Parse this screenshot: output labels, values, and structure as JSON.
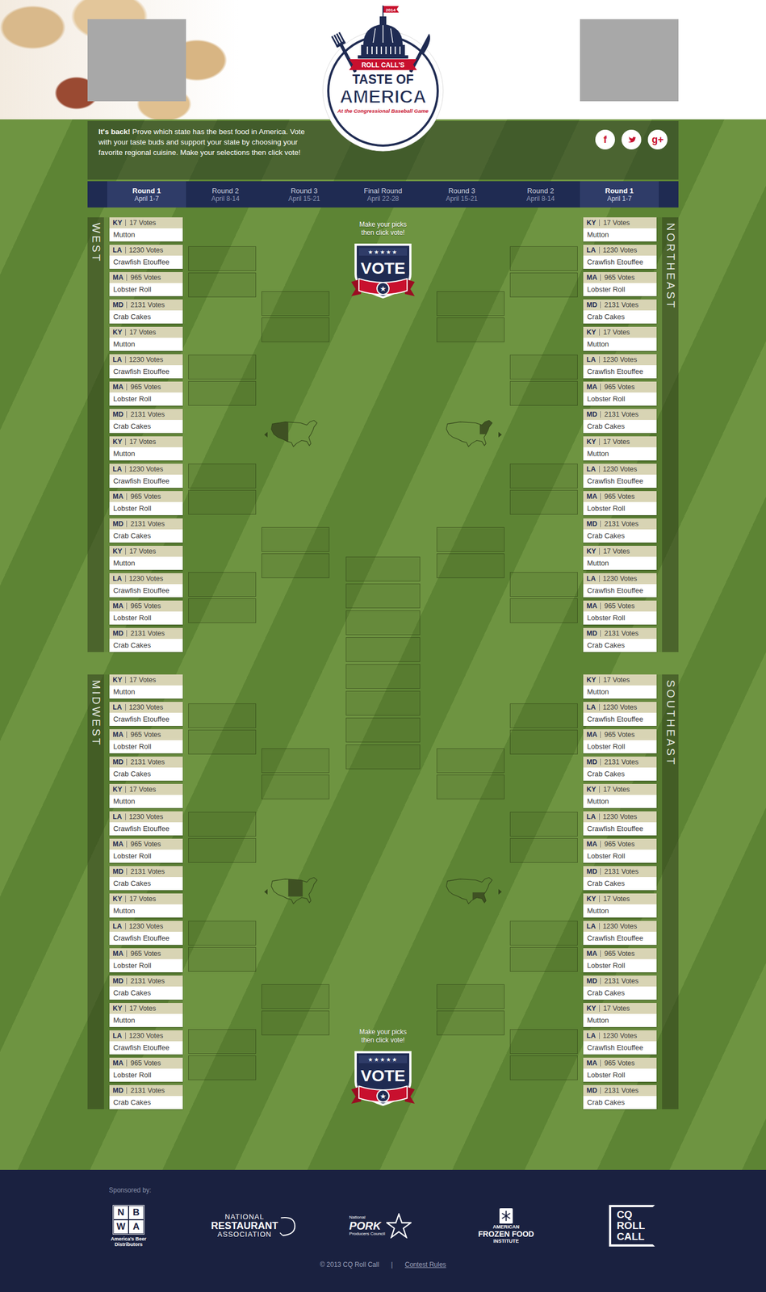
{
  "header": {
    "logo": {
      "year": "2014",
      "kicker": "ROLL CALL'S",
      "title": "TASTE OF",
      "name": "AMERICA",
      "subtitle": "At the Congressional Baseball Game"
    }
  },
  "intro": {
    "lead": "It's back!",
    "text": "Prove which state has the best food in America. Vote with your taste buds and support your state by choosing your favorite regional cuisine. Make your selections then click vote!"
  },
  "social": {
    "facebook": "f",
    "google": "g+"
  },
  "rounds": [
    {
      "label": "Round 1",
      "dates": "April 1-7",
      "selected": true
    },
    {
      "label": "Round 2",
      "dates": "April 8-14",
      "selected": false
    },
    {
      "label": "Round 3",
      "dates": "April 15-21",
      "selected": false
    },
    {
      "label": "Final Round",
      "dates": "April 22-28",
      "selected": false
    },
    {
      "label": "Round 3",
      "dates": "April 15-21",
      "selected": false
    },
    {
      "label": "Round 2",
      "dates": "April 8-14",
      "selected": false
    },
    {
      "label": "Round 1",
      "dates": "April 1-7",
      "selected": true
    }
  ],
  "vote_panels": [
    {
      "prompt": [
        "Make your picks",
        "then click vote!"
      ],
      "label": "VOTE",
      "stars": "★★★★★",
      "ribbon_star": "★"
    },
    {
      "prompt": [
        "Make your picks",
        "then click vote!"
      ],
      "label": "VOTE",
      "stars": "★★★★★",
      "ribbon_star": "★"
    }
  ],
  "regions": [
    {
      "name": "WEST",
      "entries": [
        {
          "state": "KY",
          "votes": "17 Votes",
          "food": "Mutton"
        },
        {
          "state": "LA",
          "votes": "1230 Votes",
          "food": "Crawfish Etouffee"
        },
        {
          "state": "MA",
          "votes": "965 Votes",
          "food": "Lobster Roll"
        },
        {
          "state": "MD",
          "votes": "2131 Votes",
          "food": "Crab Cakes"
        },
        {
          "state": "KY",
          "votes": "17 Votes",
          "food": "Mutton"
        },
        {
          "state": "LA",
          "votes": "1230 Votes",
          "food": "Crawfish Etouffee"
        },
        {
          "state": "MA",
          "votes": "965 Votes",
          "food": "Lobster Roll"
        },
        {
          "state": "MD",
          "votes": "2131 Votes",
          "food": "Crab Cakes"
        },
        {
          "state": "KY",
          "votes": "17 Votes",
          "food": "Mutton"
        },
        {
          "state": "LA",
          "votes": "1230 Votes",
          "food": "Crawfish Etouffee"
        },
        {
          "state": "MA",
          "votes": "965 Votes",
          "food": "Lobster Roll"
        },
        {
          "state": "MD",
          "votes": "2131 Votes",
          "food": "Crab Cakes"
        },
        {
          "state": "KY",
          "votes": "17 Votes",
          "food": "Mutton"
        },
        {
          "state": "LA",
          "votes": "1230 Votes",
          "food": "Crawfish Etouffee"
        },
        {
          "state": "MA",
          "votes": "965 Votes",
          "food": "Lobster Roll"
        },
        {
          "state": "MD",
          "votes": "2131 Votes",
          "food": "Crab Cakes"
        }
      ]
    },
    {
      "name": "NORTHEAST",
      "entries": [
        {
          "state": "KY",
          "votes": "17 Votes",
          "food": "Mutton"
        },
        {
          "state": "LA",
          "votes": "1230 Votes",
          "food": "Crawfish Etouffee"
        },
        {
          "state": "MA",
          "votes": "965 Votes",
          "food": "Lobster Roll"
        },
        {
          "state": "MD",
          "votes": "2131 Votes",
          "food": "Crab Cakes"
        },
        {
          "state": "KY",
          "votes": "17 Votes",
          "food": "Mutton"
        },
        {
          "state": "LA",
          "votes": "1230 Votes",
          "food": "Crawfish Etouffee"
        },
        {
          "state": "MA",
          "votes": "965 Votes",
          "food": "Lobster Roll"
        },
        {
          "state": "MD",
          "votes": "2131 Votes",
          "food": "Crab Cakes"
        },
        {
          "state": "KY",
          "votes": "17 Votes",
          "food": "Mutton"
        },
        {
          "state": "LA",
          "votes": "1230 Votes",
          "food": "Crawfish Etouffee"
        },
        {
          "state": "MA",
          "votes": "965 Votes",
          "food": "Lobster Roll"
        },
        {
          "state": "MD",
          "votes": "2131 Votes",
          "food": "Crab Cakes"
        },
        {
          "state": "KY",
          "votes": "17 Votes",
          "food": "Mutton"
        },
        {
          "state": "LA",
          "votes": "1230 Votes",
          "food": "Crawfish Etouffee"
        },
        {
          "state": "MA",
          "votes": "965 Votes",
          "food": "Lobster Roll"
        },
        {
          "state": "MD",
          "votes": "2131 Votes",
          "food": "Crab Cakes"
        }
      ]
    },
    {
      "name": "MIDWEST",
      "entries": [
        {
          "state": "KY",
          "votes": "17 Votes",
          "food": "Mutton"
        },
        {
          "state": "LA",
          "votes": "1230 Votes",
          "food": "Crawfish Etouffee"
        },
        {
          "state": "MA",
          "votes": "965 Votes",
          "food": "Lobster Roll"
        },
        {
          "state": "MD",
          "votes": "2131 Votes",
          "food": "Crab Cakes"
        },
        {
          "state": "KY",
          "votes": "17 Votes",
          "food": "Mutton"
        },
        {
          "state": "LA",
          "votes": "1230 Votes",
          "food": "Crawfish Etouffee"
        },
        {
          "state": "MA",
          "votes": "965 Votes",
          "food": "Lobster Roll"
        },
        {
          "state": "MD",
          "votes": "2131 Votes",
          "food": "Crab Cakes"
        },
        {
          "state": "KY",
          "votes": "17 Votes",
          "food": "Mutton"
        },
        {
          "state": "LA",
          "votes": "1230 Votes",
          "food": "Crawfish Etouffee"
        },
        {
          "state": "MA",
          "votes": "965 Votes",
          "food": "Lobster Roll"
        },
        {
          "state": "MD",
          "votes": "2131 Votes",
          "food": "Crab Cakes"
        },
        {
          "state": "KY",
          "votes": "17 Votes",
          "food": "Mutton"
        },
        {
          "state": "LA",
          "votes": "1230 Votes",
          "food": "Crawfish Etouffee"
        },
        {
          "state": "MA",
          "votes": "965 Votes",
          "food": "Lobster Roll"
        },
        {
          "state": "MD",
          "votes": "2131 Votes",
          "food": "Crab Cakes"
        }
      ]
    },
    {
      "name": "SOUTHEAST",
      "entries": [
        {
          "state": "KY",
          "votes": "17 Votes",
          "food": "Mutton"
        },
        {
          "state": "LA",
          "votes": "1230 Votes",
          "food": "Crawfish Etouffee"
        },
        {
          "state": "MA",
          "votes": "965 Votes",
          "food": "Lobster Roll"
        },
        {
          "state": "MD",
          "votes": "2131 Votes",
          "food": "Crab Cakes"
        },
        {
          "state": "KY",
          "votes": "17 Votes",
          "food": "Mutton"
        },
        {
          "state": "LA",
          "votes": "1230 Votes",
          "food": "Crawfish Etouffee"
        },
        {
          "state": "MA",
          "votes": "965 Votes",
          "food": "Lobster Roll"
        },
        {
          "state": "MD",
          "votes": "2131 Votes",
          "food": "Crab Cakes"
        },
        {
          "state": "KY",
          "votes": "17 Votes",
          "food": "Mutton"
        },
        {
          "state": "LA",
          "votes": "1230 Votes",
          "food": "Crawfish Etouffee"
        },
        {
          "state": "MA",
          "votes": "965 Votes",
          "food": "Lobster Roll"
        },
        {
          "state": "MD",
          "votes": "2131 Votes",
          "food": "Crab Cakes"
        },
        {
          "state": "KY",
          "votes": "17 Votes",
          "food": "Mutton"
        },
        {
          "state": "LA",
          "votes": "1230 Votes",
          "food": "Crawfish Etouffee"
        },
        {
          "state": "MA",
          "votes": "965 Votes",
          "food": "Lobster Roll"
        },
        {
          "state": "MD",
          "votes": "2131 Votes",
          "food": "Crab Cakes"
        }
      ]
    }
  ],
  "footer": {
    "sponsored_label": "Sponsored by:",
    "sponsors": [
      {
        "kind": "nbwa",
        "lines": [
          "N",
          "B",
          "W",
          "A",
          "America's Beer Distributors"
        ]
      },
      {
        "kind": "nra",
        "lines": [
          "NATIONAL",
          "RESTAURANT",
          "ASSOCIATION"
        ]
      },
      {
        "kind": "pork",
        "lines": [
          "National",
          "PORK",
          "Producers Council"
        ]
      },
      {
        "kind": "affi",
        "lines": [
          "AMERICAN",
          "FROZEN FOOD",
          "INSTITUTE"
        ]
      },
      {
        "kind": "cq",
        "lines": [
          "CQ",
          "ROLL",
          "CALL"
        ]
      }
    ],
    "copyright": "© 2013 CQ Roll Call",
    "separator": "|",
    "rules": "Contest Rules"
  }
}
